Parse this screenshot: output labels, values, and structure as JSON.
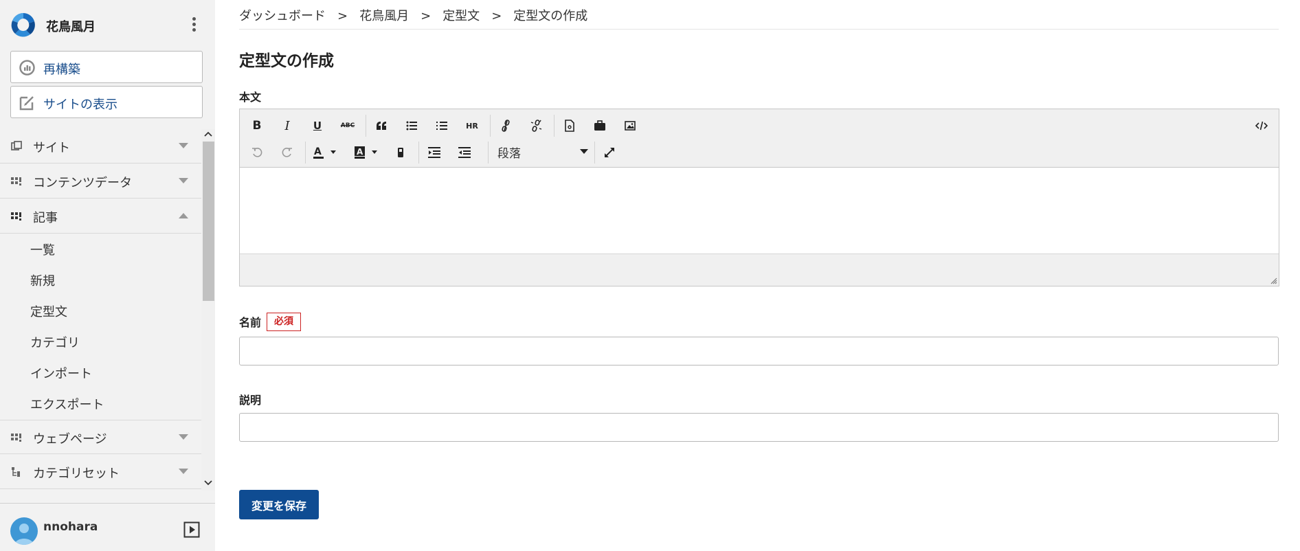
{
  "site": {
    "name": "花鳥風月"
  },
  "sidebar": {
    "rebuild_label": "再構築",
    "view_site_label": "サイトの表示",
    "nav": [
      {
        "label": "サイト",
        "icon": "site-icon",
        "expanded": false
      },
      {
        "label": "コンテンツデータ",
        "icon": "content-data-icon",
        "expanded": false
      },
      {
        "label": "記事",
        "icon": "entry-icon",
        "expanded": true
      },
      {
        "label": "ウェブページ",
        "icon": "webpage-icon",
        "expanded": false
      },
      {
        "label": "カテゴリセット",
        "icon": "category-set-icon",
        "expanded": false
      }
    ],
    "sub_items": [
      "一覧",
      "新規",
      "定型文",
      "カテゴリ",
      "インポート",
      "エクスポート"
    ]
  },
  "user": {
    "name": "nnohara"
  },
  "breadcrumb": [
    "ダッシュボード",
    "花鳥風月",
    "定型文",
    "定型文の作成"
  ],
  "breadcrumb_separator": ">",
  "page": {
    "title": "定型文の作成"
  },
  "form": {
    "body_label": "本文",
    "name_label": "名前",
    "required_badge": "必須",
    "name_value": "",
    "description_label": "説明",
    "description_value": "",
    "save_label": "変更を保存"
  },
  "editor": {
    "format_select_value": "段落",
    "toolbar_row1": [
      "bold",
      "italic",
      "underline",
      "strikethrough",
      "blockquote",
      "bullet-list",
      "numbered-list",
      "horizontal-rule",
      "link",
      "unlink",
      "insert-file",
      "insert-asset",
      "insert-image",
      "source-code"
    ],
    "toolbar_row2": [
      "undo",
      "redo",
      "text-color",
      "background-color",
      "remove-format",
      "indent",
      "outdent",
      "format-select",
      "fullscreen"
    ]
  },
  "colors": {
    "accent": "#0f4c92",
    "link": "#1a4e8c",
    "required": "#cc2222",
    "sidebar_bg": "#f2f2f2"
  }
}
